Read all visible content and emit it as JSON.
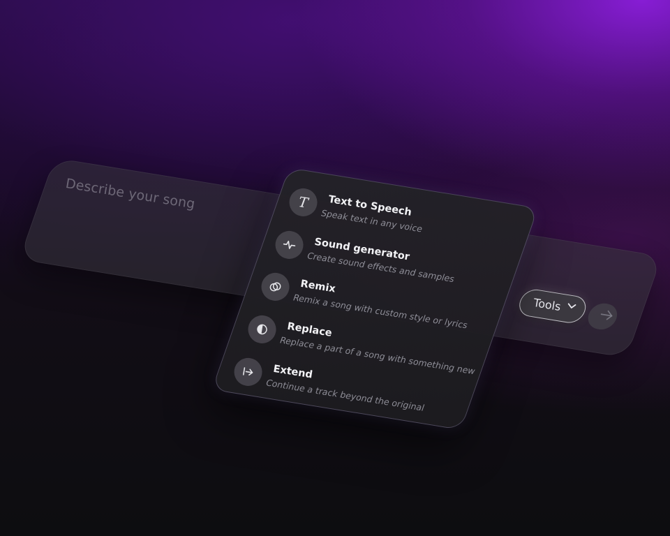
{
  "prompt": {
    "placeholder": "Describe your song"
  },
  "toolbar": {
    "tools_label": "Tools",
    "chevron_icon": "chevron-down-icon",
    "send_icon": "arrow-right-icon"
  },
  "menu": {
    "items": [
      {
        "title": "Text to Speech",
        "description": "Speak text in any voice",
        "icon": "text-t-icon"
      },
      {
        "title": "Sound generator",
        "description": "Create sound effects and samples",
        "icon": "waveform-icon"
      },
      {
        "title": "Remix",
        "description": "Remix a song with custom style or lyrics",
        "icon": "overlap-circles-icon"
      },
      {
        "title": "Replace",
        "description": "Replace a part of a song with something new",
        "icon": "half-circle-icon"
      },
      {
        "title": "Extend",
        "description": "Continue a track beyond the original",
        "icon": "extend-arrow-icon"
      }
    ]
  },
  "colors": {
    "background_top": "#7a1fd0",
    "background_bottom": "#0d0d10",
    "panel": "#242228",
    "text_primary": "#f2f2f5",
    "text_secondary": "#9d9da8"
  }
}
